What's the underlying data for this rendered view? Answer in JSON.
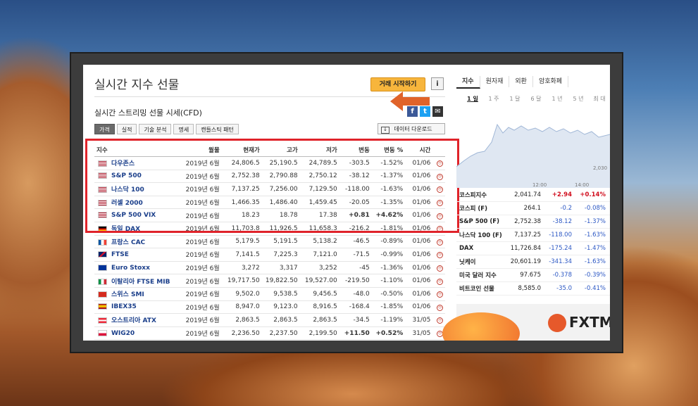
{
  "page": {
    "title": "실시간 지수 선물",
    "cta_label": "거래 시작하기",
    "info_label": "i",
    "subtitle": "실시간 스트리밍 선물 시세(CFD)",
    "download_label": "데이터 다운로드"
  },
  "tabs": [
    {
      "label": "가격",
      "active": true
    },
    {
      "label": "실적",
      "active": false
    },
    {
      "label": "기술 분석",
      "active": false
    },
    {
      "label": "명세",
      "active": false
    },
    {
      "label": "캔들스틱 패턴",
      "active": false
    }
  ],
  "table": {
    "headers": [
      "지수",
      "월물",
      "현재가",
      "고가",
      "저가",
      "변동",
      "변동 %",
      "시간"
    ],
    "rows": [
      {
        "name": "다우존스",
        "flag": "us",
        "month": "2019년 6월",
        "last": "24,806.5",
        "high": "25,190.5",
        "low": "24,789.5",
        "chg": "-303.5",
        "pct": "-1.52%",
        "time": "01/06"
      },
      {
        "name": "S&P 500",
        "flag": "us",
        "month": "2019년 6월",
        "last": "2,752.38",
        "high": "2,790.88",
        "low": "2,750.12",
        "chg": "-38.12",
        "pct": "-1.37%",
        "time": "01/06"
      },
      {
        "name": "나스닥 100",
        "flag": "us",
        "month": "2019년 6월",
        "last": "7,137.25",
        "high": "7,256.00",
        "low": "7,129.50",
        "chg": "-118.00",
        "pct": "-1.63%",
        "time": "01/06"
      },
      {
        "name": "러셀 2000",
        "flag": "us",
        "month": "2019년 6월",
        "last": "1,466.35",
        "high": "1,486.40",
        "low": "1,459.45",
        "chg": "-20.05",
        "pct": "-1.35%",
        "time": "01/06"
      },
      {
        "name": "S&P 500 VIX",
        "flag": "us",
        "month": "2019년 6월",
        "last": "18.23",
        "high": "18.78",
        "low": "17.38",
        "chg": "+0.81",
        "pct": "+4.62%",
        "time": "01/06"
      },
      {
        "name": "독일 DAX",
        "flag": "de",
        "month": "2019년 6월",
        "last": "11,703.8",
        "high": "11,926.5",
        "low": "11,658.3",
        "chg": "-216.2",
        "pct": "-1.81%",
        "time": "01/06"
      },
      {
        "name": "프랑스 CAC",
        "flag": "fr",
        "month": "2019년 6월",
        "last": "5,179.5",
        "high": "5,191.5",
        "low": "5,138.2",
        "chg": "-46.5",
        "pct": "-0.89%",
        "time": "01/06"
      },
      {
        "name": "FTSE",
        "flag": "uk",
        "month": "2019년 6월",
        "last": "7,141.5",
        "high": "7,225.3",
        "low": "7,121.0",
        "chg": "-71.5",
        "pct": "-0.99%",
        "time": "01/06"
      },
      {
        "name": "Euro Stoxx",
        "flag": "eu",
        "month": "2019년 6월",
        "last": "3,272",
        "high": "3,317",
        "low": "3,252",
        "chg": "-45",
        "pct": "-1.36%",
        "time": "01/06"
      },
      {
        "name": "이탈리아 FTSE MIB",
        "flag": "it",
        "month": "2019년 6월",
        "last": "19,717.50",
        "high": "19,822.50",
        "low": "19,527.00",
        "chg": "-219.50",
        "pct": "-1.10%",
        "time": "01/06"
      },
      {
        "name": "스위스 SMI",
        "flag": "ch",
        "month": "2019년 6월",
        "last": "9,502.0",
        "high": "9,538.5",
        "low": "9,456.5",
        "chg": "-48.0",
        "pct": "-0.50%",
        "time": "01/06"
      },
      {
        "name": "IBEX35",
        "flag": "es",
        "month": "2019년 6월",
        "last": "8,947.0",
        "high": "9,123.0",
        "low": "8,916.5",
        "chg": "-168.4",
        "pct": "-1.85%",
        "time": "01/06"
      },
      {
        "name": "오스트리아 ATX",
        "flag": "at",
        "month": "2019년 6월",
        "last": "2,863.5",
        "high": "2,863.5",
        "low": "2,863.5",
        "chg": "-34.5",
        "pct": "-1.19%",
        "time": "31/05"
      },
      {
        "name": "WIG20",
        "flag": "pl",
        "month": "2019년 6월",
        "last": "2,236.50",
        "high": "2,237.50",
        "low": "2,199.50",
        "chg": "+11.50",
        "pct": "+0.52%",
        "time": "31/05"
      }
    ]
  },
  "sidebar": {
    "tabs": [
      "지수",
      "원자재",
      "외환",
      "암호화폐"
    ],
    "periods": [
      "1 일",
      "1 주",
      "1 달",
      "6 달",
      "1 년",
      "5 년",
      "최 대"
    ],
    "chart_label_low": "2,030",
    "chart_label_time": "12:00",
    "chart_label_time2": "14:00",
    "markets": [
      {
        "name": "코스피지수",
        "value": "2,041.74",
        "chg": "+2.94",
        "pct": "+0.14%"
      },
      {
        "name": "코스피 (F)",
        "value": "264.1",
        "chg": "-0.2",
        "pct": "-0.08%"
      },
      {
        "name": "S&P 500 (F)",
        "value": "2,752.38",
        "chg": "-38.12",
        "pct": "-1.37%"
      },
      {
        "name": "나스닥 100 (F)",
        "value": "7,137.25",
        "chg": "-118.00",
        "pct": "-1.63%"
      },
      {
        "name": "DAX",
        "value": "11,726.84",
        "chg": "-175.24",
        "pct": "-1.47%"
      },
      {
        "name": "닛케이",
        "value": "20,601.19",
        "chg": "-341.34",
        "pct": "-1.63%"
      },
      {
        "name": "미국 달러 지수",
        "value": "97.675",
        "chg": "-0.378",
        "pct": "-0.39%"
      },
      {
        "name": "비트코인 선물",
        "value": "8,585.0",
        "chg": "-35.0",
        "pct": "-0.41%"
      }
    ],
    "banner_brand": "FXTM"
  },
  "colors": {
    "negative": "#2b57c4",
    "positive": "#d10f1f",
    "highlight": "#e0232a",
    "cta": "#f7b53c"
  }
}
